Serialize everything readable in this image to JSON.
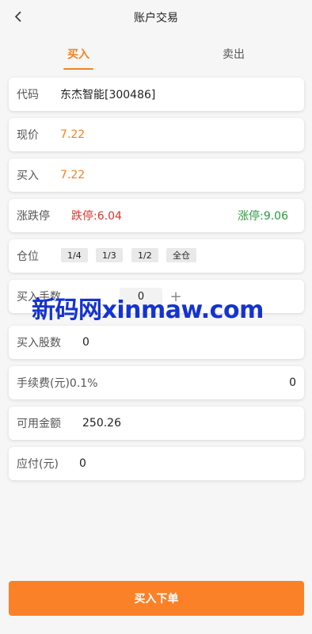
{
  "header": {
    "title": "账户交易",
    "back_icon": "chevron-left-icon"
  },
  "tabs": [
    {
      "label": "买入",
      "active": true
    },
    {
      "label": "卖出",
      "active": false
    }
  ],
  "colors": {
    "accent": "#f58220",
    "down": "#d9352b",
    "up": "#2a9d3a"
  },
  "form": {
    "code": {
      "label": "代码",
      "value": "东杰智能[300486]"
    },
    "price": {
      "label": "现价",
      "value": "7.22"
    },
    "buy": {
      "label": "买入",
      "value": "7.22"
    },
    "limit": {
      "label": "涨跌停",
      "down": "跌停:6.04",
      "up": "涨停:9.06"
    },
    "position": {
      "label": "仓位",
      "options": [
        "1/4",
        "1/3",
        "1/2",
        "全仓"
      ]
    },
    "hands": {
      "label": "买入手数",
      "value": "0",
      "plus": "+"
    },
    "shares": {
      "label": "买入股数",
      "value": "0"
    },
    "fee": {
      "label": "手续费(元)0.1%",
      "value": "0"
    },
    "available": {
      "label": "可用金额",
      "value": "250.26"
    },
    "payable": {
      "label": "应付(元)",
      "value": "0"
    }
  },
  "watermark": "新码网xinmaw.com",
  "submit_label": "买入下单"
}
